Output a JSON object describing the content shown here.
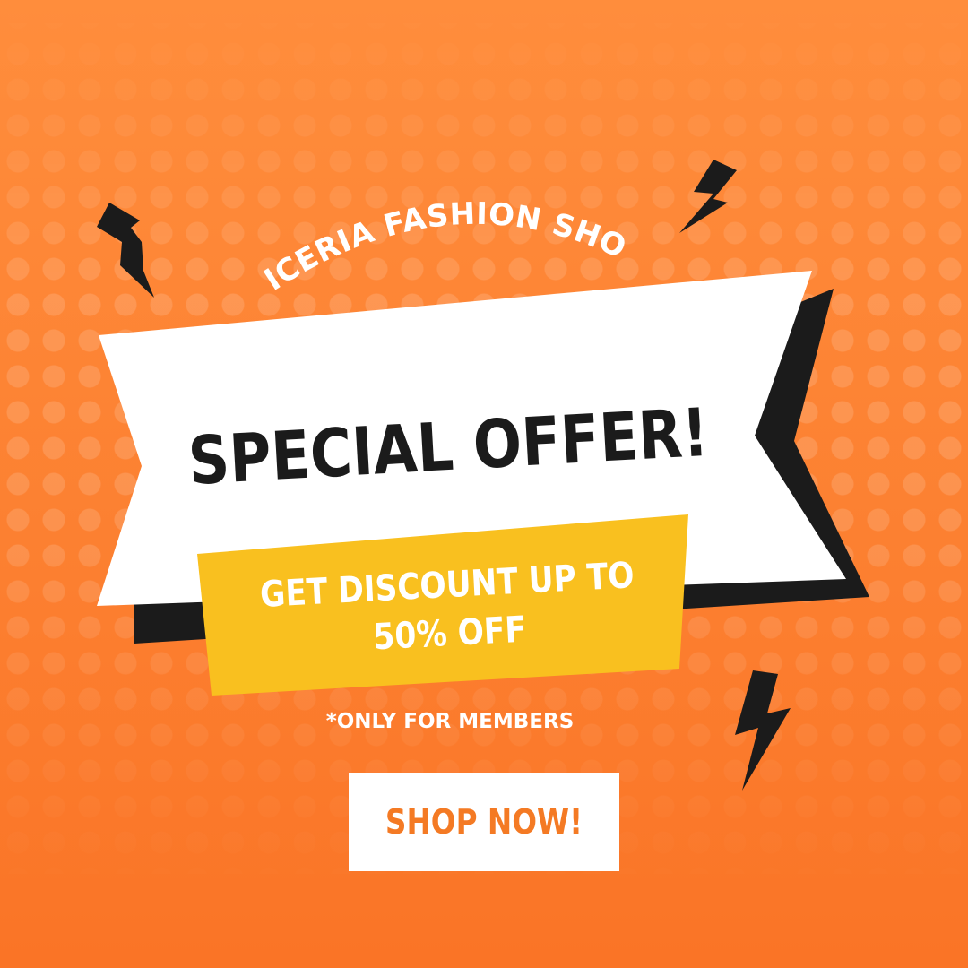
{
  "brand": {
    "name": "LICERIA FASHION SHOP"
  },
  "banner": {
    "headline": "SPECIAL OFFER!"
  },
  "promo": {
    "line1": "GET DISCOUNT UP TO",
    "line2": "50% OFF"
  },
  "note": "*ONLY FOR MEMBERS",
  "cta": {
    "label": "SHOP NOW!"
  },
  "icons": [
    "lightning-bolt-icon",
    "lightning-bolt-icon",
    "lightning-bolt-icon"
  ],
  "colors": {
    "background": "#fc7f30",
    "ribbon": "#ffffff",
    "ribbon_shadow": "#1b1b1b",
    "promo_box": "#f9c01f",
    "cta_text": "#f47a24",
    "headline_text": "#1b1b1b"
  }
}
